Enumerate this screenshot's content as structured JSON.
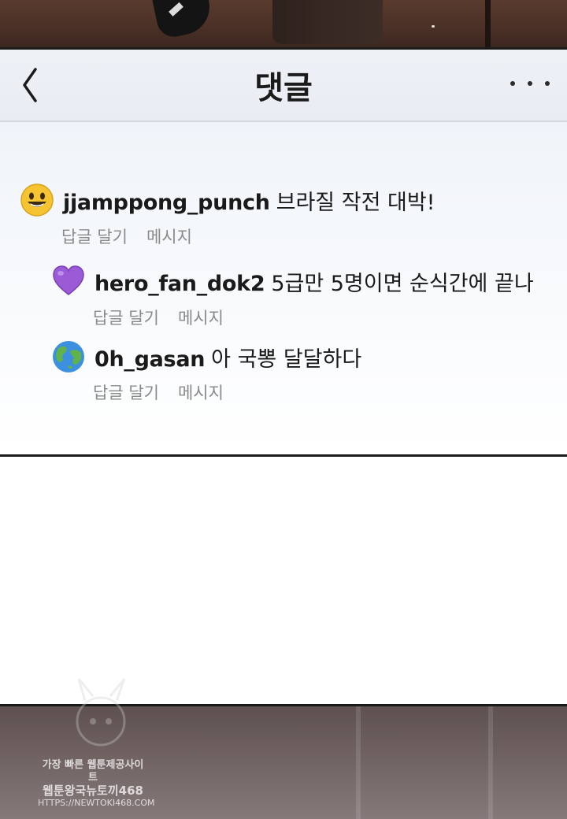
{
  "header": {
    "title": "댓글"
  },
  "comments": [
    {
      "avatar": "smiley-emoji",
      "username": "jjamppong_punch",
      "text": "브라질 작전 대박!",
      "reply_label": "답글 달기",
      "message_label": "메시지"
    },
    {
      "avatar": "purple-heart-emoji",
      "username": "hero_fan_dok2",
      "text": "5급만 5명이면 순식간에 끝나",
      "reply_label": "답글 달기",
      "message_label": "메시지"
    },
    {
      "avatar": "globe-emoji",
      "username": "0h_gasan",
      "text": "아 국뽕 달달하다",
      "reply_label": "답글 달기",
      "message_label": "메시지"
    }
  ],
  "watermark": {
    "line1": "가장 빠른 웹툰제공사이트",
    "line2": "웹툰왕국뉴토끼468",
    "line3": "HTTPS://NEWTOKI468.COM"
  },
  "colors": {
    "header_bg": "#eef2f7",
    "text": "#1a1a1a",
    "action_text": "#8a8a8a",
    "border": "#1a1a1a"
  }
}
